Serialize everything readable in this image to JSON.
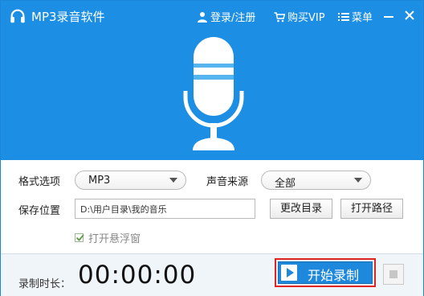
{
  "app": {
    "title": "MP3录音软件"
  },
  "topbar": {
    "login_label": "登录/注册",
    "vip_label": "购买VIP",
    "menu_label": "菜单"
  },
  "settings": {
    "format_label": "格式选项",
    "format_value": "MP3",
    "source_label": "声音来源",
    "source_value": "全部",
    "save_label": "保存位置",
    "save_path": "D:\\用户目录\\我的音乐",
    "change_dir_label": "更改目录",
    "open_path_label": "打开路径",
    "floating_window_label": "打开悬浮窗",
    "floating_window_checked": true
  },
  "footer": {
    "duration_label": "录制时长：",
    "duration_value": "00:00:00",
    "record_label": "开始录制"
  },
  "colors": {
    "header_blue": "#1c8ee3",
    "button_blue": "#1e88dd",
    "highlight_red": "#e02424"
  },
  "icons": [
    "headphones-icon",
    "user-icon",
    "cart-icon",
    "menu-icon",
    "minimize-icon",
    "close-icon",
    "microphone-icon",
    "checkmark-icon",
    "play-icon",
    "stop-icon"
  ]
}
